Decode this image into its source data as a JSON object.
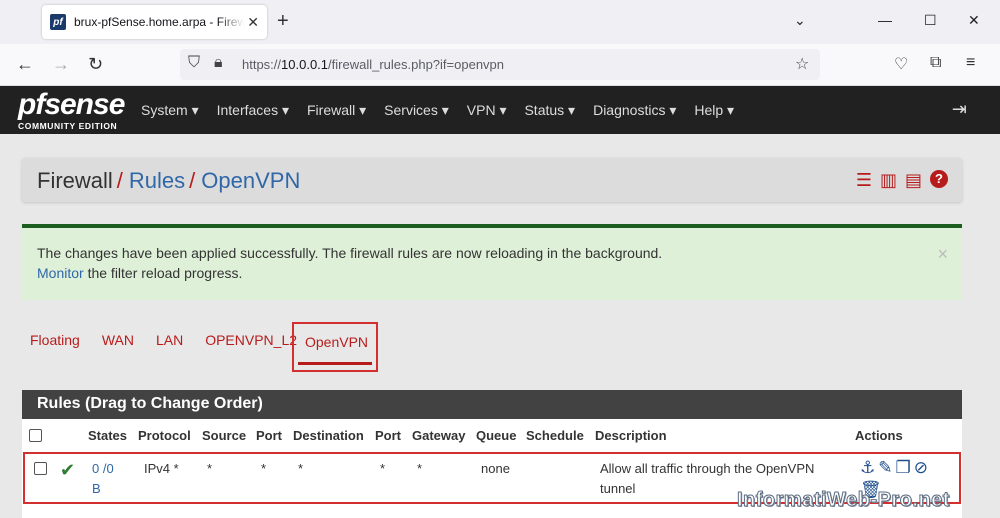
{
  "browser": {
    "tab_title": "brux-pfSense.home.arpa - Firew",
    "url_prefix": "https://",
    "url_host": "10.0.0.1",
    "url_path": "/firewall_rules.php?if=openvpn"
  },
  "header": {
    "logo_main": "pfsense",
    "logo_sub": "COMMUNITY EDITION",
    "menu": [
      "System ▾",
      "Interfaces ▾",
      "Firewall ▾",
      "Services ▾",
      "VPN ▾",
      "Status ▾",
      "Diagnostics ▾",
      "Help ▾"
    ]
  },
  "breadcrumb": {
    "part1": "Firewall",
    "part2": "Rules",
    "part3": "OpenVPN"
  },
  "alert": {
    "line1": "The changes have been applied successfully. The firewall rules are now reloading in the background.",
    "monitor_link": "Monitor",
    "line2_rest": " the filter reload progress."
  },
  "interface_tabs": [
    "Floating",
    "WAN",
    "LAN",
    "OPENVPN_L2"
  ],
  "active_tab": "OpenVPN",
  "panel_title": "Rules (Drag to Change Order)",
  "table": {
    "headers": {
      "states": "States",
      "protocol": "Protocol",
      "source": "Source",
      "port1": "Port",
      "destination": "Destination",
      "port2": "Port",
      "gateway": "Gateway",
      "queue": "Queue",
      "schedule": "Schedule",
      "description": "Description",
      "actions": "Actions"
    },
    "row": {
      "states_line1": "0 /0",
      "states_line2": "B",
      "protocol": "IPv4 *",
      "source": "*",
      "port1": "*",
      "destination": "*",
      "port2": "*",
      "gateway": "*",
      "queue": "none",
      "desc_line1": "Allow all traffic through the OpenVPN",
      "desc_line2": "tunnel"
    }
  },
  "watermark": "InformatiWeb-Pro.net",
  "colors": {
    "accent_red": "#b71c1c",
    "link_blue": "#3067a8",
    "header_dark": "#212121"
  }
}
